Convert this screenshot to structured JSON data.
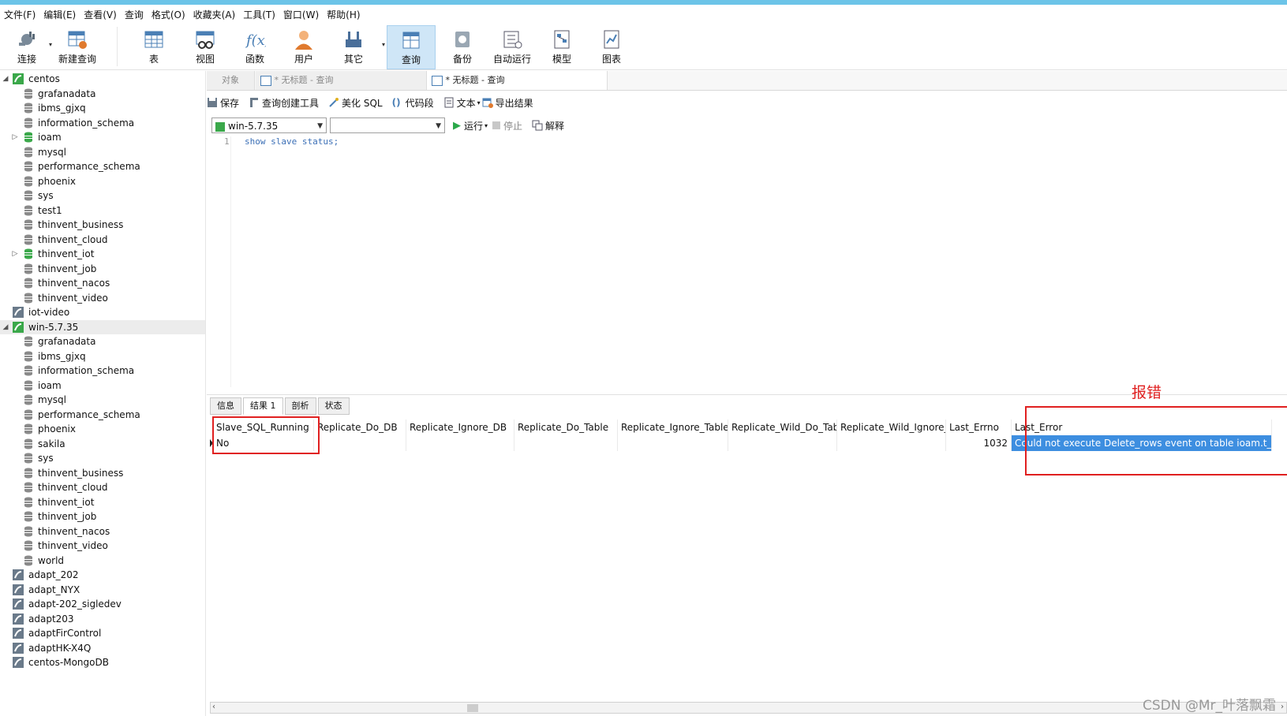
{
  "menubar": [
    "文件(F)",
    "编辑(E)",
    "查看(V)",
    "查询",
    "格式(O)",
    "收藏夹(A)",
    "工具(T)",
    "窗口(W)",
    "帮助(H)"
  ],
  "toolbar": {
    "connect": "连接",
    "new_query": "新建查询",
    "table": "表",
    "view": "视图",
    "function": "函数",
    "user": "用户",
    "other": "其它",
    "query": "查询",
    "backup": "备份",
    "auto_run": "自动运行",
    "model": "模型",
    "chart": "图表"
  },
  "sidebar": {
    "centos": "centos",
    "centos_dbs": [
      "grafanadata",
      "ibms_gjxq",
      "information_schema",
      "ioam",
      "mysql",
      "performance_schema",
      "phoenix",
      "sys",
      "test1",
      "thinvent_business",
      "thinvent_cloud",
      "thinvent_iot",
      "thinvent_job",
      "thinvent_nacos",
      "thinvent_video"
    ],
    "iot_video": "iot-video",
    "win": "win-5.7.35",
    "win_dbs": [
      "grafanadata",
      "ibms_gjxq",
      "information_schema",
      "ioam",
      "mysql",
      "performance_schema",
      "phoenix",
      "sakila",
      "sys",
      "thinvent_business",
      "thinvent_cloud",
      "thinvent_iot",
      "thinvent_job",
      "thinvent_nacos",
      "thinvent_video",
      "world"
    ],
    "others": [
      "adapt_202",
      "adapt_NYX",
      "adapt-202_sigledev",
      "adapt203",
      "adaptFirControl",
      "adaptHK-X4Q",
      "centos-MongoDB"
    ]
  },
  "tabs": {
    "objects": "对象",
    "untitled1": "* 无标题 - 查询",
    "untitled2": "* 无标题 - 查询"
  },
  "query_toolbar": {
    "save": "保存",
    "builder": "查询创建工具",
    "beautify": "美化 SQL",
    "snippet": "代码段",
    "text": "文本",
    "export": "导出结果"
  },
  "conn_row": {
    "connection": "win-5.7.35",
    "database": "",
    "run": "运行",
    "stop": "停止",
    "explain": "解释"
  },
  "editor": {
    "line": "1",
    "code": "show slave status;"
  },
  "result_tabs": [
    "信息",
    "结果 1",
    "剖析",
    "状态"
  ],
  "grid": {
    "columns": [
      "Slave_SQL_Running",
      "Replicate_Do_DB",
      "Replicate_Ignore_DB",
      "Replicate_Do_Table",
      "Replicate_Ignore_Table",
      "Replicate_Wild_Do_Table",
      "Replicate_Wild_Ignore_Ta",
      "Last_Errno",
      "Last_Error"
    ],
    "row": [
      "No",
      "",
      "",
      "",
      "",
      "",
      "",
      "1032",
      "Could not execute Delete_rows event on table ioam.t_view_sw"
    ]
  },
  "annotation": "报错",
  "watermark": "CSDN @Mr_叶落飘霜",
  "colors": {
    "accent": "#3d8ee0",
    "annotation": "#e02020",
    "titlebar": "#6cc4e8"
  }
}
